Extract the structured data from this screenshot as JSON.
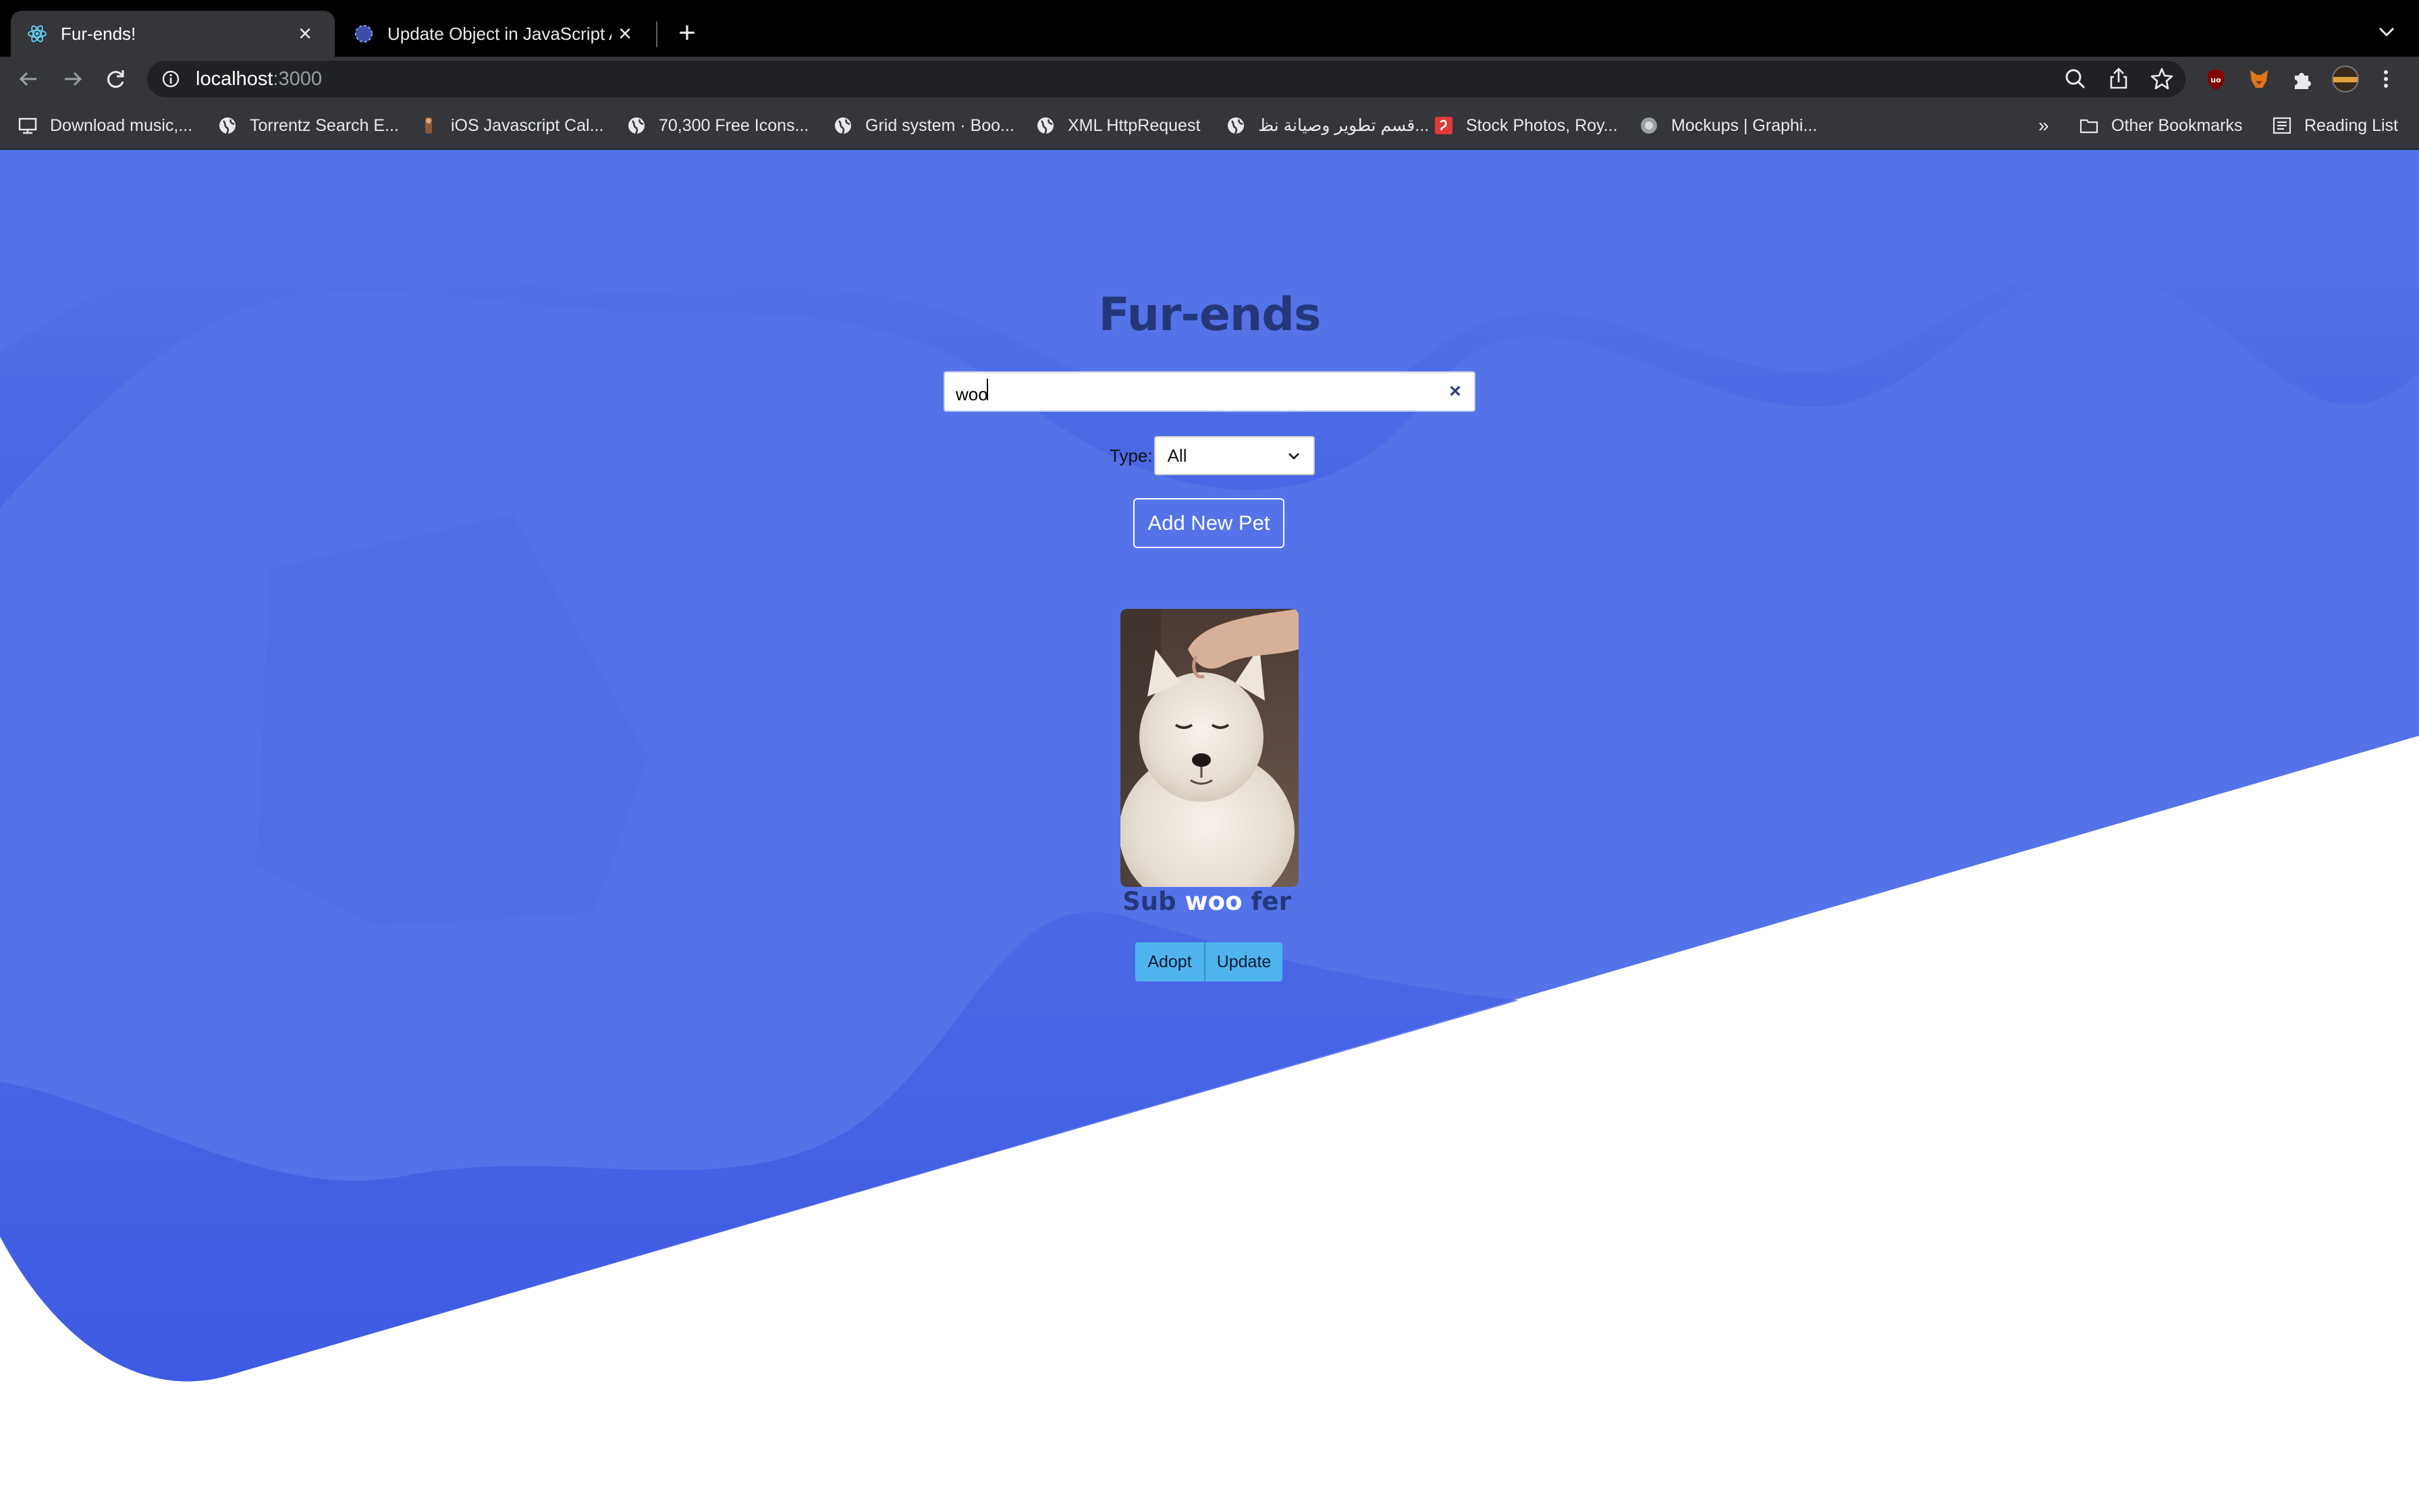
{
  "browser": {
    "tabs": [
      {
        "title": "Fur-ends!",
        "active": true,
        "icon": "react-icon"
      },
      {
        "title": "Update Object in JavaScript Ar",
        "active": false,
        "icon": "globe-icon"
      }
    ],
    "url": {
      "host": "localhost",
      "port": ":3000"
    },
    "bookmarks": [
      {
        "label": "Download music,...",
        "icon": "screen-icon"
      },
      {
        "label": "Torrentz Search E...",
        "icon": "globe-icon"
      },
      {
        "label": "iOS Javascript Cal...",
        "icon": "person-icon"
      },
      {
        "label": "70,300 Free Icons...",
        "icon": "globe-icon"
      },
      {
        "label": "Grid system · Boo...",
        "icon": "globe-icon"
      },
      {
        "label": "XML HttpRequest",
        "icon": "globe-icon"
      },
      {
        "label": "قسم تطوير وصيانة نظ...",
        "icon": "globe-icon"
      },
      {
        "label": "Stock Photos, Roy...",
        "icon": "stock-icon"
      },
      {
        "label": "Mockups | Graphi...",
        "icon": "circle-icon"
      }
    ],
    "overflow_label": "»",
    "other_bookmarks": "Other Bookmarks",
    "reading_list": "Reading List"
  },
  "app": {
    "title": "Fur-ends",
    "search": {
      "value": "woo",
      "placeholder": "",
      "clear_label": "×"
    },
    "filter": {
      "label": "Type:",
      "selected": "All"
    },
    "add_button": "Add New Pet",
    "pets": [
      {
        "name_prefix": "Sub ",
        "name_match": "woo",
        "name_suffix": " fer",
        "actions": {
          "adopt": "Adopt",
          "update": "Update"
        }
      }
    ]
  },
  "colors": {
    "background_blue": "#5473E8",
    "wave_blue": "#3D5BE4",
    "title_navy": "#243779",
    "button_cyan": "#4FB4EE"
  }
}
